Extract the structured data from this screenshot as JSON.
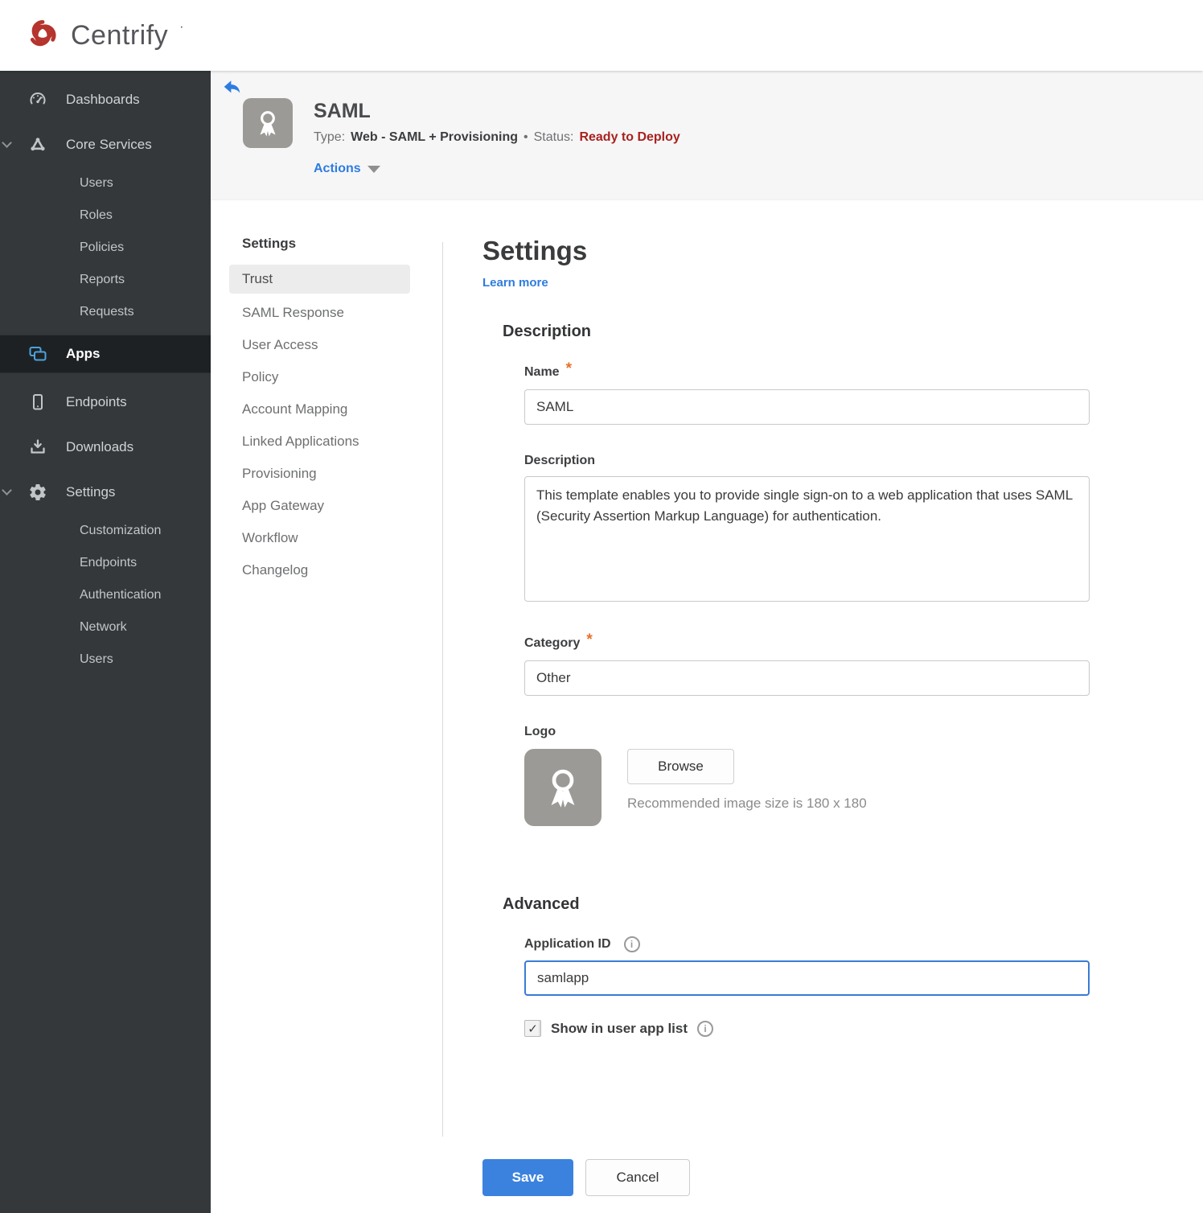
{
  "header": {
    "brand": "Centrify",
    "brand_mark": "·"
  },
  "sidebar": {
    "dashboards": "Dashboards",
    "core_services": "Core Services",
    "core_children": [
      "Users",
      "Roles",
      "Policies",
      "Reports",
      "Requests"
    ],
    "apps": "Apps",
    "endpoints": "Endpoints",
    "downloads": "Downloads",
    "settings": "Settings",
    "settings_children": [
      "Customization",
      "Endpoints",
      "Authentication",
      "Network",
      "Users"
    ]
  },
  "app_header": {
    "title": "SAML",
    "type_label": "Type:",
    "type_value": "Web - SAML + Provisioning",
    "separator": "•",
    "status_label": "Status:",
    "status_value": "Ready to Deploy",
    "actions_label": "Actions"
  },
  "subnav": {
    "heading": "Settings",
    "selected": "Trust",
    "items": [
      "Trust",
      "SAML Response",
      "User Access",
      "Policy",
      "Account Mapping",
      "Linked Applications",
      "Provisioning",
      "App Gateway",
      "Workflow",
      "Changelog"
    ]
  },
  "main": {
    "title": "Settings",
    "learn_more": "Learn more",
    "description": {
      "heading": "Description",
      "name_label": "Name",
      "name_value": "SAML",
      "desc_label": "Description",
      "desc_value": "This template enables you to provide single sign-on to a web application that uses SAML (Security Assertion Markup Language) for authentication.",
      "category_label": "Category",
      "category_value": "Other",
      "logo_label": "Logo",
      "browse_label": "Browse",
      "logo_hint": "Recommended image size is 180 x 180"
    },
    "advanced": {
      "heading": "Advanced",
      "app_id_label": "Application ID",
      "app_id_value": "samlapp",
      "show_label": "Show in user app list",
      "show_checked": true
    },
    "buttons": {
      "save": "Save",
      "cancel": "Cancel"
    }
  },
  "icons": {
    "check": "✓",
    "info": "i",
    "asterisk": "*"
  },
  "colors": {
    "link_blue": "#2e7ce0",
    "save_blue": "#3b82de",
    "status_red": "#a8221e",
    "apps_icon_blue": "#4ba3dc",
    "sidebar_bg": "#34383b",
    "header_band": "#f6f6f7"
  }
}
